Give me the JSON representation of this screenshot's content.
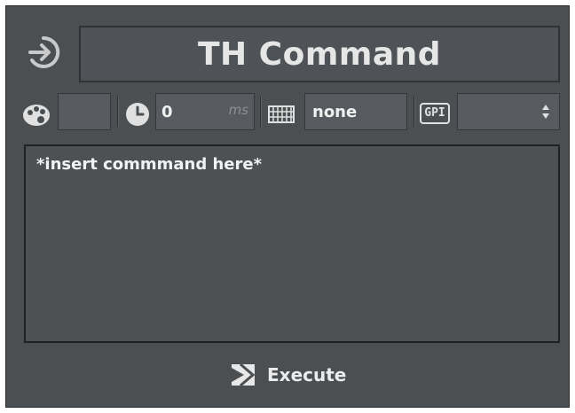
{
  "header": {
    "title": "TH Command",
    "icon": "login-enter-icon"
  },
  "toolbar": {
    "color": {
      "icon": "palette-icon",
      "value": ""
    },
    "delay": {
      "icon": "clock-icon",
      "value": "0",
      "unit": "ms"
    },
    "keyboard": {
      "icon": "keyboard-icon",
      "value": "none"
    },
    "gpi": {
      "icon_text": "GPI",
      "value": ""
    }
  },
  "command": {
    "text": "*insert commmand here*"
  },
  "execute": {
    "label": "Execute",
    "icon": "execute-icon"
  },
  "colors": {
    "panel_bg": "#4b4f52",
    "field_bg": "#575b5f",
    "text": "#e6e6e6"
  }
}
